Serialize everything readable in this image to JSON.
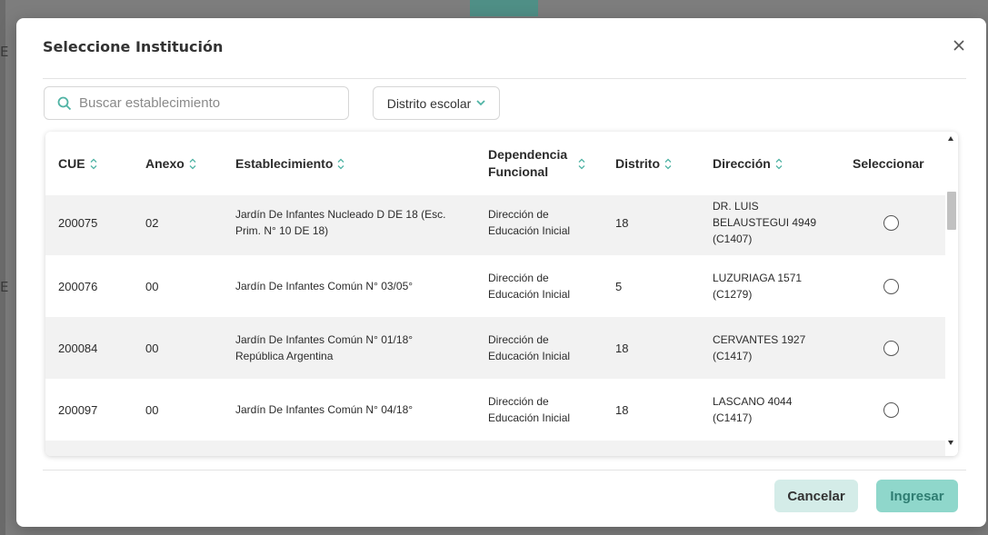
{
  "modal": {
    "title": "Seleccione Institución",
    "close_icon": "close-icon"
  },
  "search": {
    "placeholder": "Buscar establecimiento",
    "value": ""
  },
  "district_filter": {
    "label": "Distrito escolar"
  },
  "table": {
    "headers": {
      "cue": "CUE",
      "anexo": "Anexo",
      "establecimiento": "Establecimiento",
      "dependencia_1": "Dependencia",
      "dependencia_2": "Funcional",
      "distrito": "Distrito",
      "direccion": "Dirección",
      "seleccionar": "Seleccionar"
    },
    "rows": [
      {
        "cue": "200075",
        "anexo": "02",
        "establecimiento_1": "Jardín De Infantes Nucleado D DE 18 (Esc.",
        "establecimiento_2": "Prim. N° 10 DE 18)",
        "dependencia_1": "Dirección de",
        "dependencia_2": "Educación Inicial",
        "distrito": "18",
        "direccion_1": "DR. LUIS",
        "direccion_2": "BELAUSTEGUI 4949",
        "direccion_3": "(C1407)"
      },
      {
        "cue": "200076",
        "anexo": "00",
        "establecimiento_1": "Jardín De Infantes Común N° 03/05°",
        "establecimiento_2": "",
        "dependencia_1": "Dirección de",
        "dependencia_2": "Educación Inicial",
        "distrito": "5",
        "direccion_1": "LUZURIAGA 1571",
        "direccion_2": "(C1279)",
        "direccion_3": ""
      },
      {
        "cue": "200084",
        "anexo": "00",
        "establecimiento_1": "Jardín De Infantes Común N° 01/18°",
        "establecimiento_2": "República Argentina",
        "dependencia_1": "Dirección de",
        "dependencia_2": "Educación Inicial",
        "distrito": "18",
        "direccion_1": "CERVANTES 1927",
        "direccion_2": "(C1417)",
        "direccion_3": ""
      },
      {
        "cue": "200097",
        "anexo": "00",
        "establecimiento_1": "Jardín De Infantes Común N° 04/18°",
        "establecimiento_2": "",
        "dependencia_1": "Dirección de",
        "dependencia_2": "Educación Inicial",
        "distrito": "18",
        "direccion_1": "LASCANO 4044",
        "direccion_2": "(C1417)",
        "direccion_3": ""
      }
    ]
  },
  "footer": {
    "cancel_label": "Cancelar",
    "submit_label": "Ingresar"
  },
  "background": {
    "partial_letters": [
      "E",
      "E"
    ]
  },
  "colors": {
    "primary": "#8fd7cb",
    "primary_text": "#2f7d72",
    "secondary": "#d4ece8",
    "search_icon": "#4fb3a4"
  }
}
